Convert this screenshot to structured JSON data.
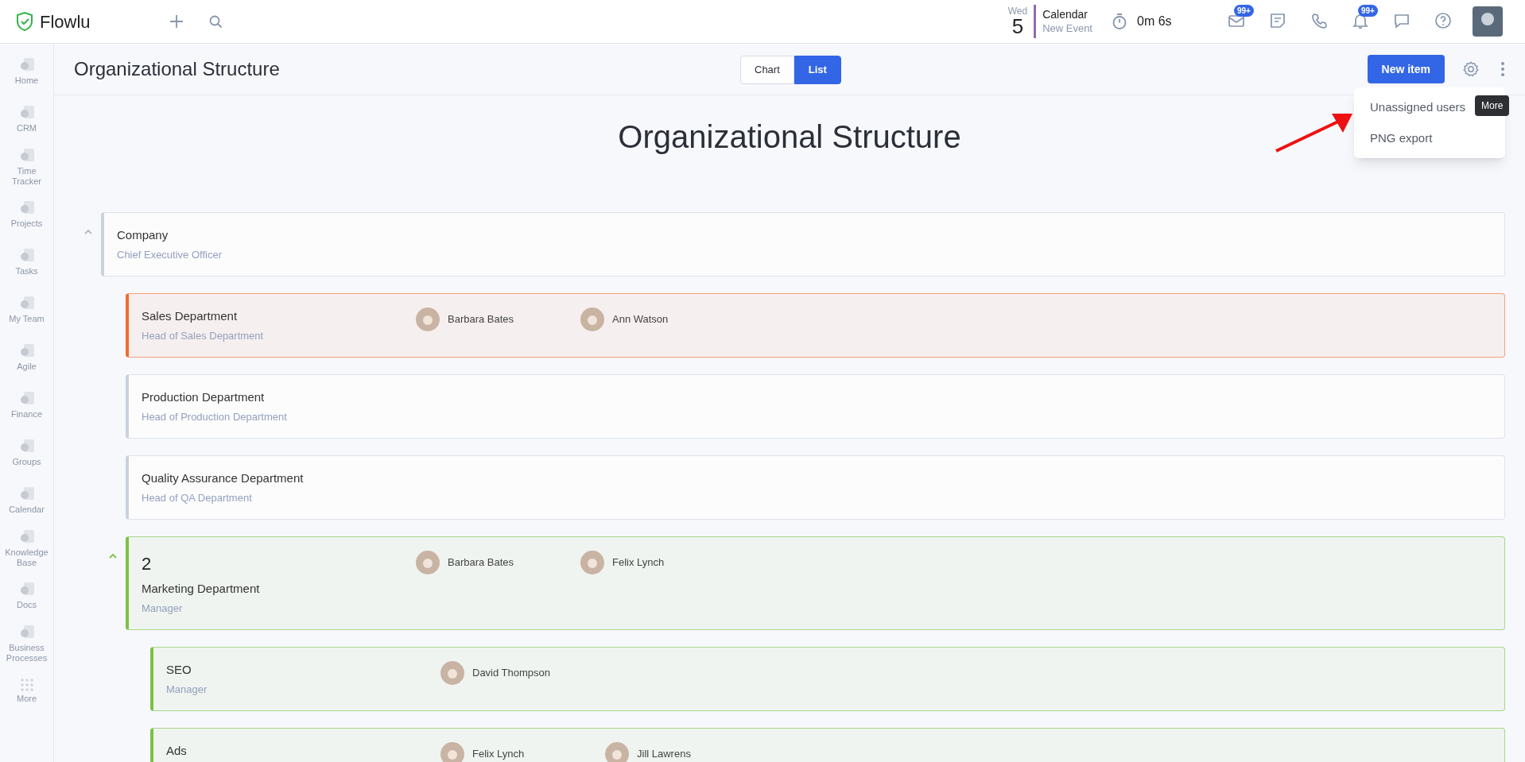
{
  "app": {
    "logo": "Flowlu"
  },
  "calendar": {
    "weekday": "Wed",
    "day": "5",
    "title": "Calendar",
    "event": "New Event"
  },
  "timer": "0m 6s",
  "notifications": [
    {
      "kind": "mail",
      "badge": "99+"
    },
    {
      "kind": "notes"
    },
    {
      "kind": "phone"
    },
    {
      "kind": "bell",
      "badge": "99+"
    },
    {
      "kind": "chat"
    },
    {
      "kind": "help"
    }
  ],
  "sidebar": {
    "items": [
      {
        "label": "Home"
      },
      {
        "label": "CRM"
      },
      {
        "label": "Time Tracker"
      },
      {
        "label": "Projects"
      },
      {
        "label": "Tasks"
      },
      {
        "label": "My Team"
      },
      {
        "label": "Agile"
      },
      {
        "label": "Finance"
      },
      {
        "label": "Groups"
      },
      {
        "label": "Calendar"
      },
      {
        "label": "Knowledge Base"
      },
      {
        "label": "Docs"
      },
      {
        "label": "Business Processes"
      },
      {
        "label": "More",
        "kind": "more"
      }
    ]
  },
  "header": {
    "title": "Organizational Structure",
    "view_tabs": [
      {
        "label": "Chart",
        "selected": false
      },
      {
        "label": "List",
        "selected": true
      }
    ],
    "new_button": "New item",
    "more_tooltip": "More"
  },
  "menu": {
    "items": [
      "Unassigned users",
      "PNG export"
    ]
  },
  "heading": "Organizational Structure",
  "tree": [
    {
      "title": "Company",
      "subtitle": "Chief Executive Officer",
      "color": "#cbd2de",
      "expanded": true,
      "children": [
        {
          "title": "Sales Department",
          "subtitle": "Head of Sales Department",
          "color": "#f5692e",
          "members": [
            "Barbara Bates",
            "Ann Watson"
          ]
        },
        {
          "title": "Production Department",
          "subtitle": "Head of Production Department",
          "color": "#cbd2de"
        },
        {
          "title": "Quality Assurance Department",
          "subtitle": "Head of QA Department",
          "color": "#cbd2de"
        },
        {
          "number": "2",
          "title": "Marketing Department",
          "subtitle": "Manager",
          "color": "#7cc242",
          "expanded": true,
          "members": [
            "Barbara Bates",
            "Felix Lynch"
          ],
          "children": [
            {
              "title": "SEO",
              "subtitle": "Manager",
              "color": "#7cc242",
              "members": [
                "David Thompson"
              ]
            },
            {
              "title": "Ads",
              "color": "#7cc242",
              "members": [
                "Felix Lynch",
                "Jill Lawrens"
              ]
            }
          ]
        }
      ]
    }
  ]
}
